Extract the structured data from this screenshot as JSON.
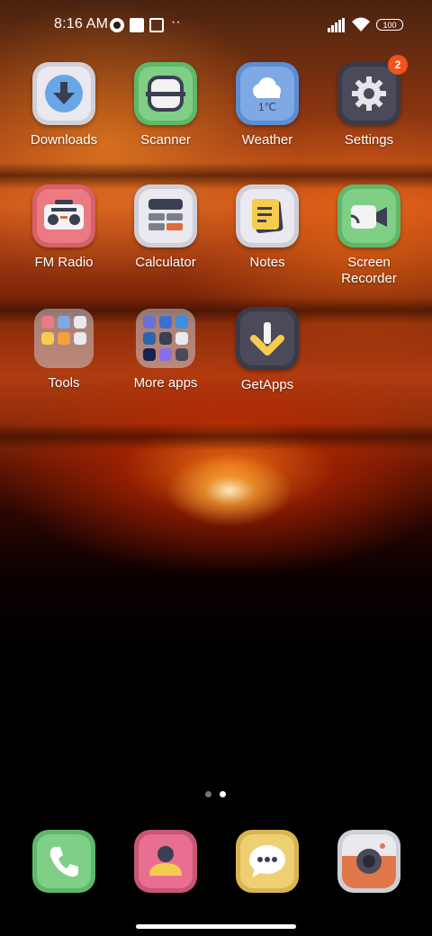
{
  "status_bar": {
    "time": "8:16 AM",
    "battery": "100",
    "icons": [
      "data-saver-icon",
      "notification-square-icon",
      "upload-icon",
      "more-dots-icon",
      "signal-icon",
      "wifi-icon",
      "battery-icon"
    ]
  },
  "apps": [
    {
      "label": "Downloads",
      "icon": "download-icon"
    },
    {
      "label": "Scanner",
      "icon": "scanner-icon"
    },
    {
      "label": "Weather",
      "icon": "weather-icon",
      "temp": "1℃"
    },
    {
      "label": "Settings",
      "icon": "gear-icon",
      "badge": "2"
    },
    {
      "label": "FM Radio",
      "icon": "radio-icon"
    },
    {
      "label": "Calculator",
      "icon": "calculator-icon"
    },
    {
      "label": "Notes",
      "icon": "notes-icon"
    },
    {
      "label": "Screen Recorder",
      "line1": "Screen",
      "line2": "Recorder",
      "icon": "video-camera-icon"
    },
    {
      "label": "Tools",
      "icon": "folder-icon"
    },
    {
      "label": "More apps",
      "icon": "folder-icon"
    },
    {
      "label": "GetApps",
      "icon": "getapps-icon"
    }
  ],
  "page_indicator": {
    "pages": 2,
    "current": 2
  },
  "dock": [
    {
      "icon": "phone-icon"
    },
    {
      "icon": "contacts-icon"
    },
    {
      "icon": "messages-icon"
    },
    {
      "icon": "camera-icon"
    }
  ],
  "colors": {
    "badge": "#f2521b",
    "downloads": "#e9e9ef",
    "scanner": "#7fcf86",
    "weather": "#7ea9e4",
    "settings": "#4a4a5a",
    "radio": "#ec7a82",
    "calculator": "#e9e9ef",
    "notes": "#e9e9ef",
    "recorder": "#7fcf86",
    "getapps": "#4a4a5a",
    "phone": "#7fcf86",
    "contacts": "#e86f8f",
    "messages": "#efcf74",
    "camera": "#e9e9ef"
  }
}
